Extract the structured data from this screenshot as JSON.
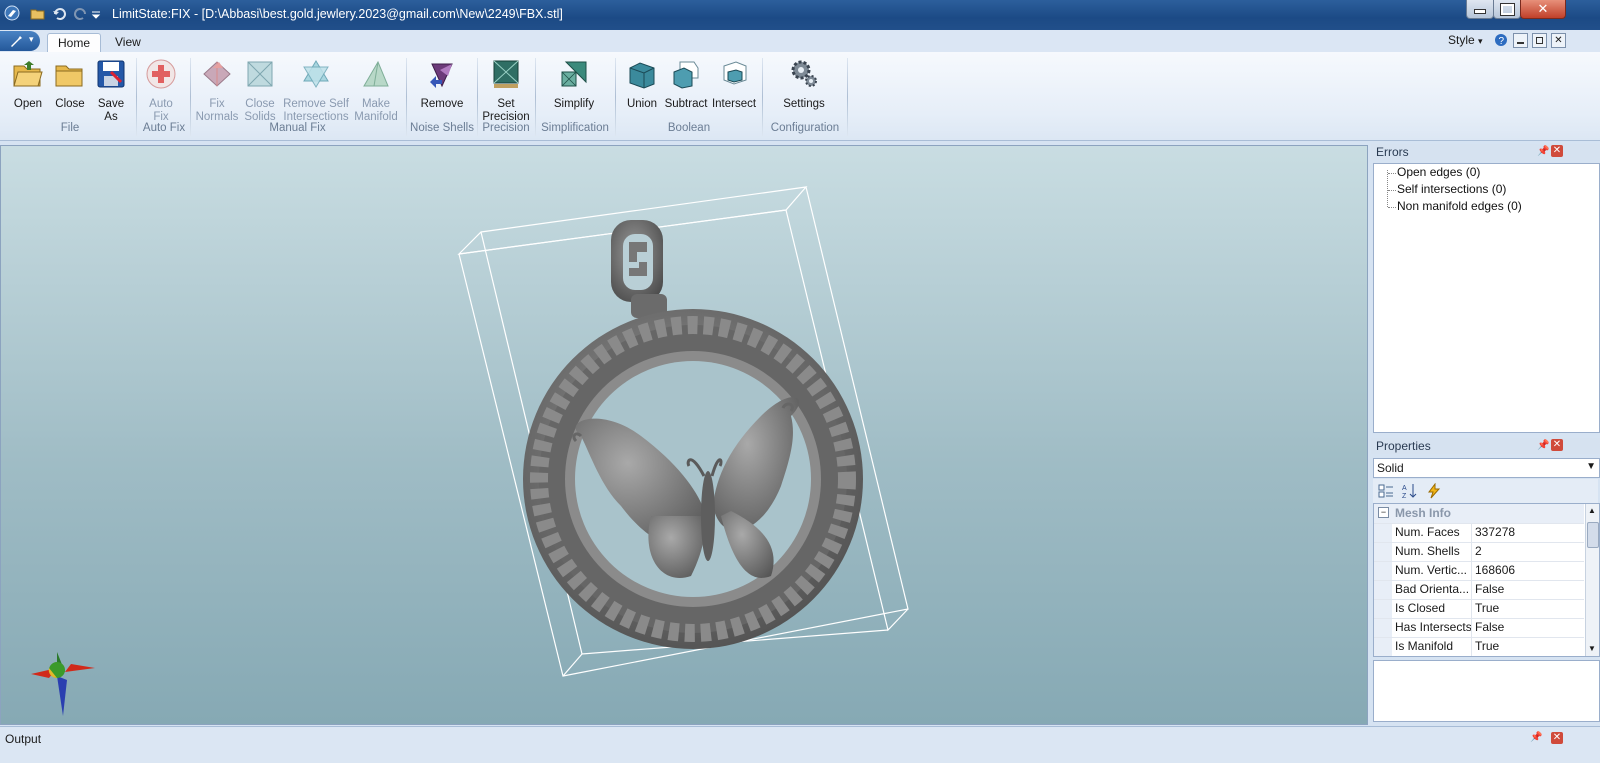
{
  "window": {
    "title": "LimitState:FIX - [D:\\Abbasi\\best.gold.jewlery.2023@gmail.com\\New\\2249\\FBX.stl]"
  },
  "tabs": [
    {
      "label": "Home",
      "active": true
    },
    {
      "label": "View",
      "active": false
    }
  ],
  "style_menu": {
    "label": "Style"
  },
  "ribbon": {
    "buttons": {
      "open": "Open",
      "close": "Close",
      "save_as_1": "Save",
      "save_as_2": "As",
      "auto_fix_1": "Auto",
      "auto_fix_2": "Fix",
      "fix_normals_1": "Fix",
      "fix_normals_2": "Normals",
      "close_solids_1": "Close",
      "close_solids_2": "Solids",
      "remove_self_1": "Remove Self",
      "remove_self_2": "Intersections",
      "make_manifold_1": "Make",
      "make_manifold_2": "Manifold",
      "remove": "Remove",
      "set_precision_1": "Set",
      "set_precision_2": "Precision",
      "simplify": "Simplify",
      "union": "Union",
      "subtract": "Subtract",
      "intersect": "Intersect",
      "settings": "Settings"
    },
    "groups": {
      "file": "File",
      "auto_fix": "Auto Fix",
      "manual_fix": "Manual Fix",
      "noise_shells": "Noise Shells",
      "precision": "Precision",
      "simplification": "Simplification",
      "boolean": "Boolean",
      "configuration": "Configuration"
    }
  },
  "errors_panel": {
    "title": "Errors",
    "items": [
      "Open edges (0)",
      "Self intersections (0)",
      "Non manifold edges (0)"
    ]
  },
  "properties_panel": {
    "title": "Properties",
    "object_select": "Solid",
    "section": "Mesh Info",
    "rows": [
      {
        "key": "Num. Faces",
        "value": "337278"
      },
      {
        "key": "Num. Shells",
        "value": "2"
      },
      {
        "key": "Num. Vertic...",
        "value": "168606"
      },
      {
        "key": "Bad Orienta...",
        "value": "False"
      },
      {
        "key": "Is Closed",
        "value": "True"
      },
      {
        "key": "Has Intersects",
        "value": "False"
      },
      {
        "key": "Is Manifold",
        "value": "True"
      }
    ]
  },
  "output_panel": {
    "title": "Output"
  }
}
